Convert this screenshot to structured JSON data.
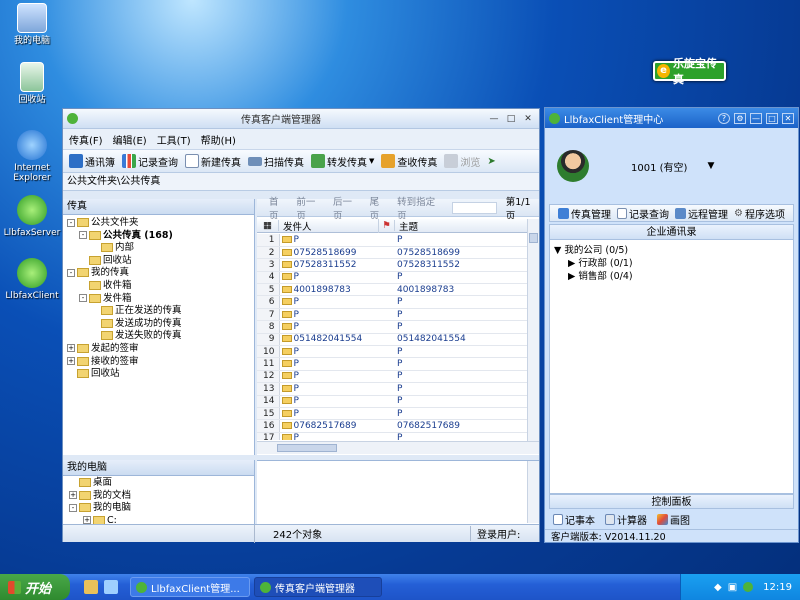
{
  "desktop": {
    "icons": [
      "我的电脑",
      "回收站",
      "Internet Explorer",
      "LlbfaxServer",
      "LlbfaxClient"
    ],
    "logo_badge": "乐旋宝传真"
  },
  "main": {
    "title": "传真客户端管理器",
    "menu": [
      "传真(F)",
      "编辑(E)",
      "工具(T)",
      "帮助(H)"
    ],
    "toolbar": [
      "通讯簿",
      "记录查询",
      "新建传真",
      "扫描传真",
      "转发传真",
      "查收传真",
      "浏览"
    ],
    "path": "公共文件夹\\公共传真",
    "left_header": "传真",
    "tree": [
      {
        "label": "公共文件夹",
        "level": 0,
        "exp": "-"
      },
      {
        "label": "公共传真 (168)",
        "level": 1,
        "exp": "-",
        "bold": true
      },
      {
        "label": "内部",
        "level": 2,
        "exp": ""
      },
      {
        "label": "回收站",
        "level": 1,
        "exp": ""
      },
      {
        "label": "我的传真",
        "level": 0,
        "exp": "-"
      },
      {
        "label": "收件箱",
        "level": 1,
        "exp": ""
      },
      {
        "label": "发件箱",
        "level": 1,
        "exp": "-"
      },
      {
        "label": "正在发送的传真",
        "level": 2,
        "exp": ""
      },
      {
        "label": "发送成功的传真",
        "level": 2,
        "exp": ""
      },
      {
        "label": "发送失败的传真",
        "level": 2,
        "exp": ""
      },
      {
        "label": "发起的签审",
        "level": 0,
        "exp": "+"
      },
      {
        "label": "接收的签审",
        "level": 0,
        "exp": "+"
      },
      {
        "label": "回收站",
        "level": 0,
        "exp": ""
      }
    ],
    "pager": {
      "first": "首页",
      "prev": "前一页",
      "next": "后一页",
      "last": "尾页",
      "goto": "转到指定页",
      "page": "第1/1页"
    },
    "columns": [
      "发件人",
      "主题"
    ],
    "rows": [
      [
        "1",
        "P",
        "P"
      ],
      [
        "2",
        "07528518699",
        "07528518699"
      ],
      [
        "3",
        "07528311552",
        "07528311552"
      ],
      [
        "4",
        "P",
        "P"
      ],
      [
        "5",
        "4001898783",
        "4001898783"
      ],
      [
        "6",
        "P",
        "P"
      ],
      [
        "7",
        "P",
        "P"
      ],
      [
        "8",
        "P",
        "P"
      ],
      [
        "9",
        "051482041554",
        "051482041554"
      ],
      [
        "10",
        "P",
        "P"
      ],
      [
        "11",
        "P",
        "P"
      ],
      [
        "12",
        "P",
        "P"
      ],
      [
        "13",
        "P",
        "P"
      ],
      [
        "14",
        "P",
        "P"
      ],
      [
        "15",
        "P",
        "P"
      ],
      [
        "16",
        "07682517689",
        "07682517689"
      ],
      [
        "17",
        "P",
        "P"
      ]
    ],
    "bottom_left_header": "我的电脑",
    "bottom_tree": [
      "桌面",
      "我的文档",
      "我的电脑",
      "C:"
    ],
    "status_count": "242个对象",
    "status_login": "登录用户:"
  },
  "client": {
    "title": "LlbfaxClient管理中心",
    "user": "1001 (有空)",
    "nav": [
      "传真管理",
      "记录查询",
      "远程管理",
      "程序选项"
    ],
    "section": "企业通讯录",
    "tree": [
      "我的公司 (0/5)",
      "行政部 (0/1)",
      "销售部 (0/4)"
    ],
    "control_panel": "控制面板",
    "tools": [
      "记事本",
      "计算器",
      "画图"
    ],
    "version": "客户端版本: V2014.11.20"
  },
  "taskbar": {
    "start": "开始",
    "tasks": [
      "LlbfaxClient管理...",
      "传真客户端管理器"
    ],
    "clock": "12:19"
  }
}
